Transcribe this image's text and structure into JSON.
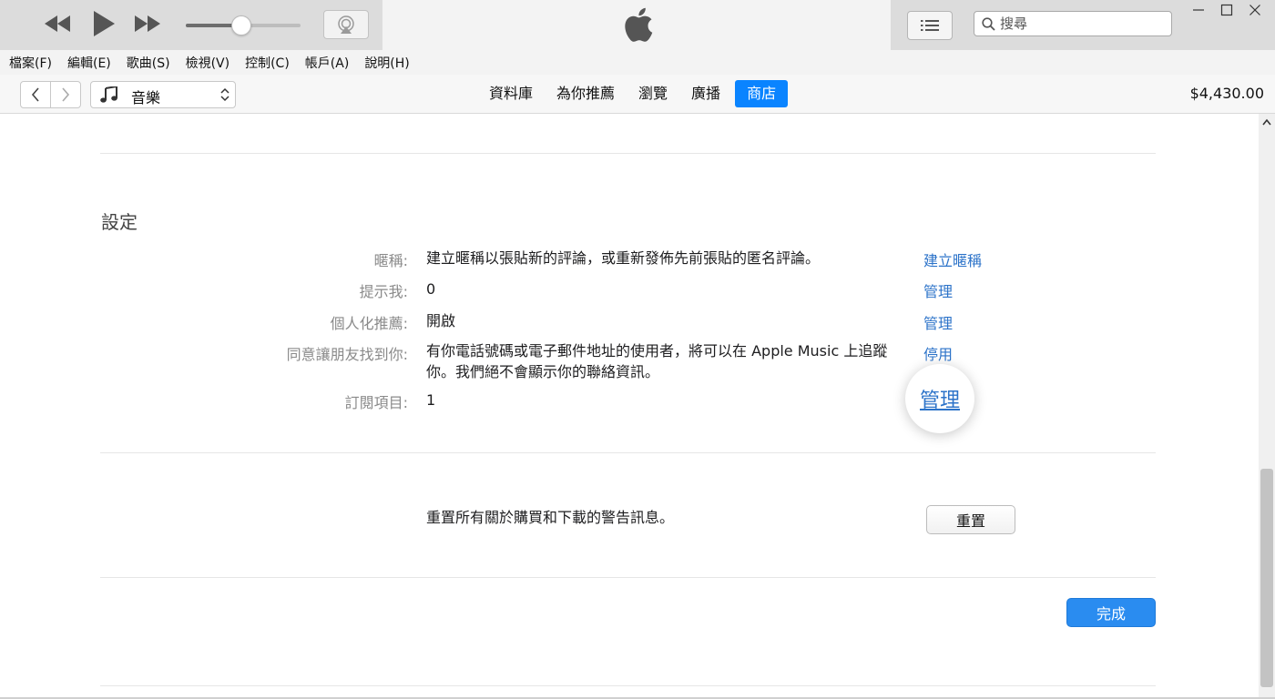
{
  "menu": [
    "檔案(F)",
    "編輯(E)",
    "歌曲(S)",
    "檢視(V)",
    "控制(C)",
    "帳戶(A)",
    "說明(H)"
  ],
  "player": {
    "volume_percent": 48
  },
  "search": {
    "placeholder": "搜尋"
  },
  "library_selector": {
    "label": "音樂"
  },
  "tabs": [
    {
      "label": "資料庫",
      "active": false
    },
    {
      "label": "為你推薦",
      "active": false
    },
    {
      "label": "瀏覽",
      "active": false
    },
    {
      "label": "廣播",
      "active": false
    },
    {
      "label": "商店",
      "active": true
    }
  ],
  "account": {
    "balance": "$4,430.00"
  },
  "settings": {
    "title": "設定",
    "rows": [
      {
        "label": "暱稱:",
        "value": "建立暱稱以張貼新的評論，或重新發佈先前張貼的匿名評論。",
        "action": "建立暱稱"
      },
      {
        "label": "提示我:",
        "value": "0",
        "action": "管理"
      },
      {
        "label": "個人化推薦:",
        "value": "開啟",
        "action": "管理"
      },
      {
        "label": "同意讓朋友找到你:",
        "value": "有你電話號碼或電子郵件地址的使用者，將可以在 Apple Music 上追蹤你。我們絕不會顯示你的聯絡資訊。",
        "action": "停用"
      },
      {
        "label": "訂閱項目:",
        "value": "1",
        "action": "管理"
      }
    ]
  },
  "reset": {
    "text": "重置所有關於購買和下載的警告訊息。",
    "button": "重置"
  },
  "done_button": "完成",
  "colors": {
    "accent": "#0a84ff",
    "link": "#2c73c9",
    "done": "#2a8cf0"
  }
}
